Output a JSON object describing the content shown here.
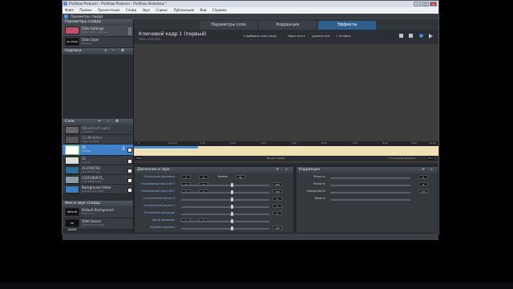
{
  "window": {
    "title": "ProShow Producer - ProShow Producer - ProShow Slideshow *",
    "controls": [
      "–",
      "□",
      "×"
    ]
  },
  "menu": [
    "Файл",
    "Правка",
    "Презентация",
    "Слайд",
    "Звук",
    "Сервис",
    "Публикация",
    "Вид",
    "Справка"
  ],
  "dialog_title": "Параметры слайда",
  "left_panel": {
    "slide_options_header": "Параметры слайда",
    "slide_items": [
      {
        "label": "Slide Settings",
        "sub": "Slide 1 of 1 - 10.0 sec",
        "thumb": ""
      },
      {
        "label": "Slide Style",
        "sub": "No Style",
        "thumb": "no style"
      }
    ],
    "captions_header": "Надписи",
    "layers_header": "Слои",
    "layers": [
      {
        "num": "",
        "name": "Adjustment Layer",
        "sub": "(disabled)"
      },
      {
        "num": "",
        "name": "12 (Modifier)",
        "sub": "Layer modifier"
      },
      {
        "num": "3",
        "name": "12",
        "sub": "12.png",
        "selected": true
      },
      {
        "num": "",
        "name": "11",
        "sub": "11.png"
      },
      {
        "num": "",
        "name": "213740703",
        "sub": "213740703.jpg"
      },
      {
        "num": "",
        "name": "1325180972_",
        "sub": "1325180972.jpg"
      },
      {
        "num": "",
        "name": "Background Video",
        "sub": "Background Video"
      }
    ],
    "bg_header": "Фон и звук слайда",
    "bg_items": [
      {
        "label": "Default Background",
        "sub": "Solid Color",
        "thumb": "default"
      },
      {
        "label": "Slide Sound",
        "sub": "Set Sound to Slide",
        "thumb": "no sound"
      }
    ]
  },
  "tabs": [
    {
      "label": "Параметры слоя",
      "active": false
    },
    {
      "label": "Коррекция",
      "active": false
    },
    {
      "label": "Эффекты",
      "active": true
    }
  ],
  "keyframe": {
    "title": "Ключевой кадр 1 (первый)",
    "time": "Time: 0.00 (00)",
    "toolbar": [
      "+ добавить ключ.кадр",
      "сброс всего",
      "удалить все",
      "+ вставка"
    ]
  },
  "timeline": {
    "ticks": [
      "0",
      "1,00 sec",
      "2,00",
      "3,00",
      "4,00",
      "5,00",
      "6,00",
      "7,00",
      "8,00",
      "9,00",
      "10,00"
    ],
    "start_label": "Start",
    "end_label": "End",
    "center_label": "Время слайда",
    "right_label": "Отношение времени"
  },
  "motion_panel": {
    "title": "Движения и звук",
    "rows": [
      {
        "label": "Отклонение движения",
        "v1": "0",
        "v2": "0",
        "extra": "Кривая",
        "v3": "56"
      },
      {
        "label": "Отклоняемый масштаб X",
        "v1": "0",
        "v2": "0",
        "v3": "100"
      },
      {
        "label": "Отклоняемый масштаб Y",
        "v1": "0",
        "v2": "0",
        "v3": "100"
      },
      {
        "label": "Отклоненный наклон X",
        "v1": "",
        "v2": "",
        "v3": "0"
      },
      {
        "label": "Отклоненный наклон Y",
        "v1": "",
        "v2": "",
        "v3": "0"
      },
      {
        "label": "Отклонение вращения",
        "v1": "",
        "v2": "",
        "v3": "0"
      },
      {
        "label": "Центр вращения",
        "v1": "0",
        "v2": "0",
        "v3": ""
      },
      {
        "label": "Звуковая дорожка",
        "v1": "",
        "v2": "",
        "v3": "100"
      }
    ]
  },
  "correction_panel": {
    "title": "Коррекция",
    "rows": [
      {
        "label": "Резкость",
        "v": "0"
      },
      {
        "label": "Резкость",
        "v": "0"
      },
      {
        "label": "Прозрачность",
        "v": "100"
      },
      {
        "label": "Яркость",
        "v": ""
      }
    ]
  }
}
